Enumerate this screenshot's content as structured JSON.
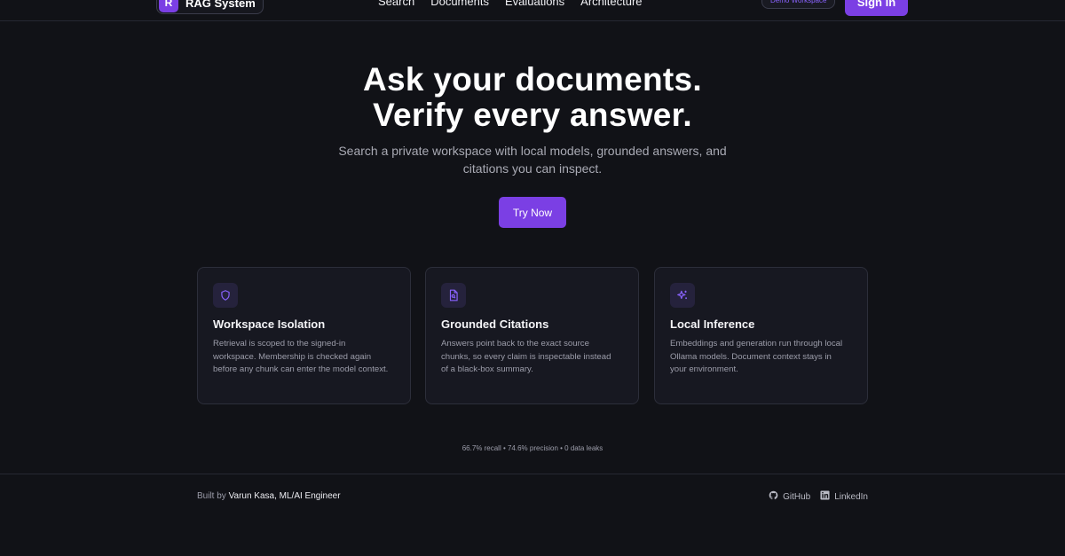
{
  "header": {
    "logo_mark": "R",
    "logo_text": "RAG System",
    "nav": [
      "Search",
      "Documents",
      "Evaluations",
      "Architecture"
    ],
    "demo_badge": "Demo Workspace",
    "signin_label": "Sign In"
  },
  "hero": {
    "title_line1": "Ask your documents.",
    "title_line2": "Verify every answer.",
    "subtitle": "Search a private workspace with local models, grounded answers, and citations you can inspect.",
    "cta_label": "Try Now"
  },
  "features": [
    {
      "icon": "shield-icon",
      "title": "Workspace Isolation",
      "body": "Retrieval is scoped to the signed-in workspace. Membership is checked again before any chunk can enter the model context."
    },
    {
      "icon": "file-search-icon",
      "title": "Grounded Citations",
      "body": "Answers point back to the exact source chunks, so every claim is inspectable instead of a black-box summary."
    },
    {
      "icon": "sparkles-icon",
      "title": "Local Inference",
      "body": "Embeddings and generation run through local Ollama models. Document context stays in your environment."
    }
  ],
  "stats": "66.7% recall • 74.6% precision • 0 data leaks",
  "footer": {
    "built_prefix": "Built by",
    "author": "Varun Kasa, ML/AI Engineer",
    "links": [
      {
        "label": "GitHub",
        "icon": "github-icon"
      },
      {
        "label": "LinkedIn",
        "icon": "linkedin-icon"
      }
    ]
  },
  "colors": {
    "background": "#111217",
    "accent": "#7b3fe4",
    "card": "#171821"
  }
}
